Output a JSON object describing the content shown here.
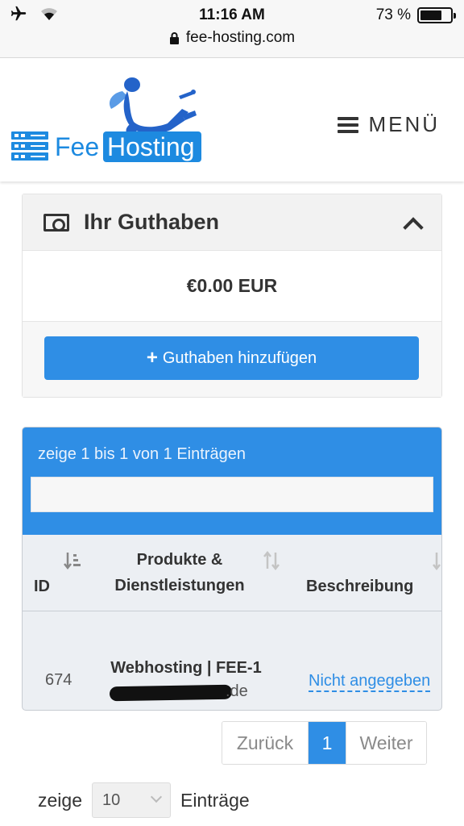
{
  "status_bar": {
    "time": "11:16 AM",
    "battery": "73 %",
    "battery_level": 0.73,
    "url": "fee-hosting.com"
  },
  "header": {
    "logo_text_1": "Fee",
    "logo_text_2": "Hosting",
    "menu_label": "MENÜ"
  },
  "credit": {
    "title": "Ihr Guthaben",
    "amount": "€0.00 EUR",
    "add_button": "Guthaben hinzufügen"
  },
  "table": {
    "info": "zeige 1 bis 1 von 1 Einträgen",
    "columns": {
      "id": "ID",
      "product_line1": "Produkte &",
      "product_line2": "Dienstleistungen",
      "description": "Beschreibung"
    },
    "rows": [
      {
        "id": "674",
        "product": "Webhosting | FEE-1",
        "domain_suffix": ".de",
        "description": "Nicht angegeben"
      }
    ]
  },
  "pagination": {
    "prev": "Zurück",
    "current": "1",
    "next": "Weiter"
  },
  "length": {
    "prefix": "zeige",
    "value": "10",
    "suffix": "Einträge"
  },
  "colors": {
    "accent": "#2f8ee5",
    "logo_blue": "#1d8ae0",
    "panel_gray": "#f2f2f2"
  }
}
